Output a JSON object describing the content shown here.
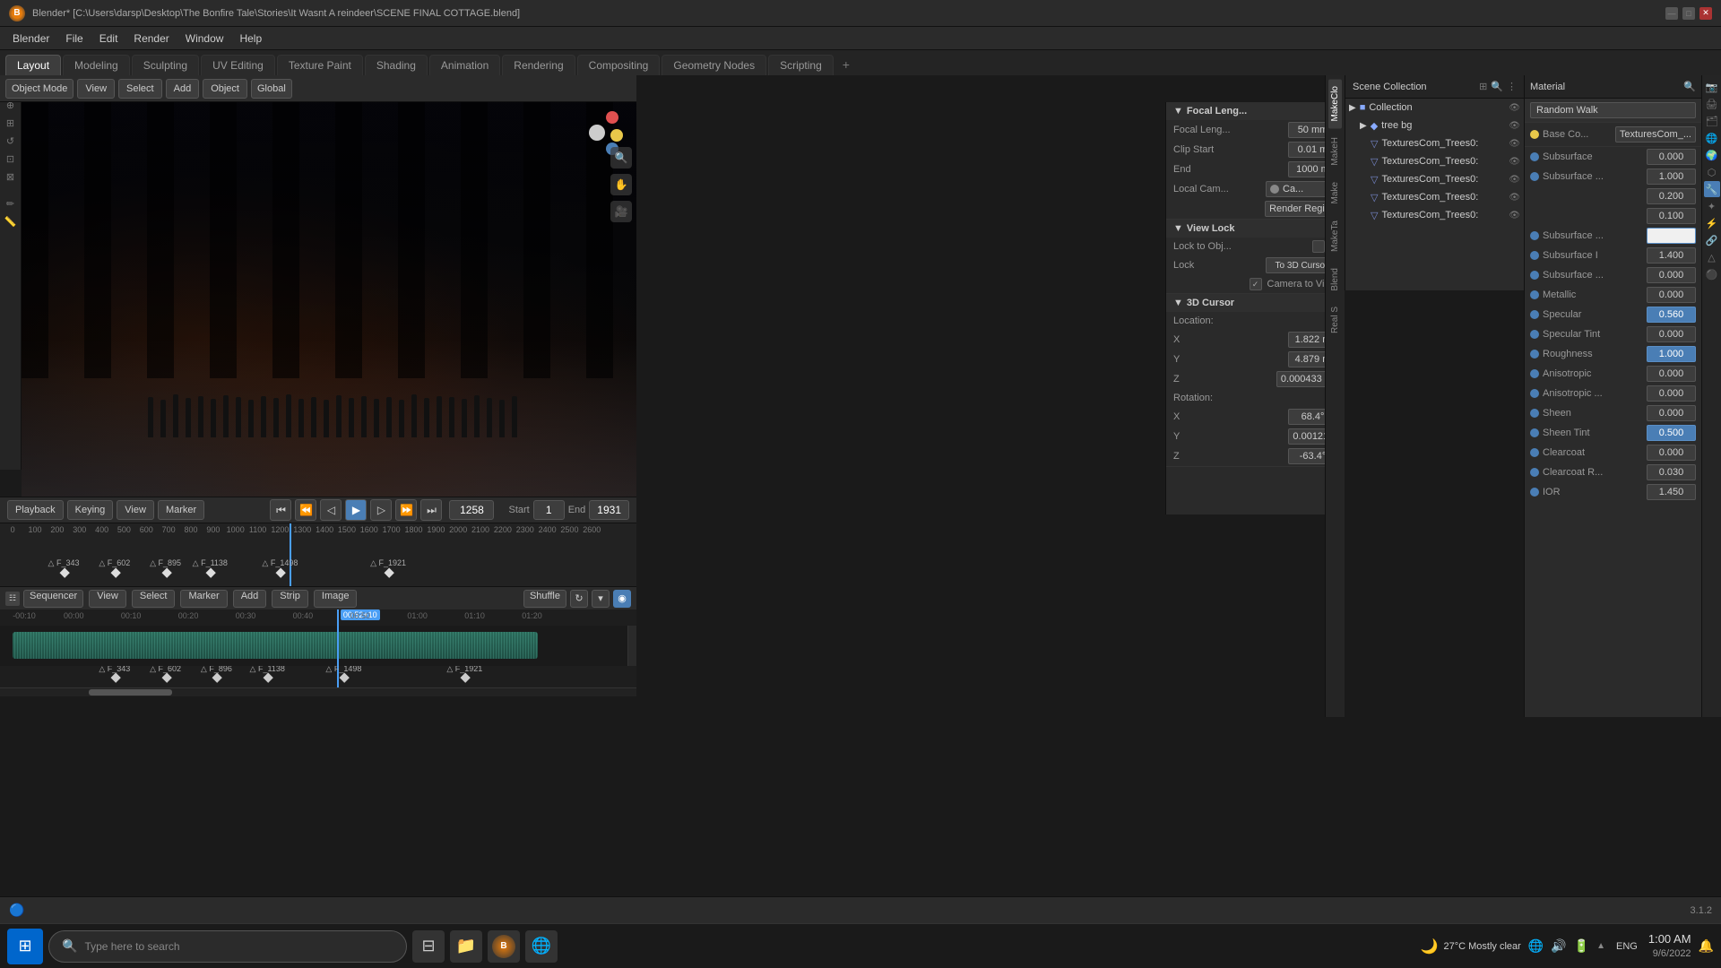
{
  "window": {
    "title": "Blender* [C:\\Users\\darsp\\Desktop\\The Bonfire Tale\\Stories\\It Wasnt A reindeer\\SCENE FINAL COTTAGE.blend]",
    "controls": {
      "minimize": "—",
      "maximize": "□",
      "close": "✕"
    }
  },
  "menu": {
    "items": [
      "Blender",
      "File",
      "Edit",
      "Render",
      "Window",
      "Help"
    ]
  },
  "workspaces": {
    "tabs": [
      "Layout",
      "Modeling",
      "Sculpting",
      "UV Editing",
      "Texture Paint",
      "Shading",
      "Animation",
      "Rendering",
      "Compositing",
      "Geometry Nodes",
      "Scripting"
    ],
    "active": "Layout"
  },
  "toolbar": {
    "mode": "Object Mode",
    "view": "View",
    "select": "Select",
    "add": "Add",
    "object": "Object",
    "transform": "Global",
    "pivot": "⊙"
  },
  "viewport": {
    "focal_length_label": "Focal Leng...",
    "focal_length_value": "50 mm",
    "clip_start_label": "Clip Start",
    "clip_start_value": "0.01 m",
    "end_label": "End",
    "end_value": "1000 m",
    "local_cam_label": "Local Cam...",
    "local_cam_value": "Ca...",
    "render_region_label": "Render Regi...",
    "view_lock_label": "View Lock",
    "lock_to_obj_label": "Lock to Obj...",
    "lock_to_cursor_label": "To 3D Cursor",
    "lock": "Lock",
    "camera_to_vi_label": "Camera to Vi...",
    "cursor_label": "3D Cursor",
    "cursor_location": {
      "x_label": "X",
      "x_value": "1.822 m",
      "y_label": "Y",
      "y_value": "4.879 m",
      "z_label": "Z",
      "z_value": "0.000433 m"
    },
    "cursor_rotation": {
      "label": "Rotation:",
      "x_label": "X",
      "x_value": "68.4°",
      "y_label": "Y",
      "y_value": "0.00121°",
      "z_label": "Z",
      "z_value": "-63.4°"
    }
  },
  "scene_outliner": {
    "collection_label": "Scene Collection",
    "collection": "Collection",
    "tree_bg": "tree bg",
    "items": [
      "TexturesCom_Trees0:",
      "TexturesCom_Trees0:",
      "TexturesCom_Trees0:",
      "TexturesCom_Trees0:",
      "TexturesCom_Trees0:"
    ]
  },
  "material": {
    "shader": "Random Walk",
    "base_color_label": "Base Co...",
    "base_color_value": "TexturesCom_...",
    "properties": [
      {
        "label": "Subsurface",
        "value": "0.000",
        "dot": "blue"
      },
      {
        "label": "Subsurface ...",
        "value": "1.000",
        "dot": "blue"
      },
      {
        "label": "",
        "value": "0.200",
        "dot": null
      },
      {
        "label": "",
        "value": "0.100",
        "dot": null
      },
      {
        "label": "Subsurface ...",
        "value": "",
        "dot": "blue",
        "white_box": true
      },
      {
        "label": "Subsurface I",
        "value": "1.400",
        "dot": "blue"
      },
      {
        "label": "Subsurface ...",
        "value": "0.000",
        "dot": "blue"
      },
      {
        "label": "Metallic",
        "value": "0.000",
        "dot": "blue"
      },
      {
        "label": "Specular",
        "value": "0.560",
        "dot": "blue",
        "highlighted": true
      },
      {
        "label": "Specular Tint",
        "value": "0.000",
        "dot": "blue"
      },
      {
        "label": "Roughness",
        "value": "1.000",
        "dot": "blue",
        "highlighted": true
      },
      {
        "label": "Anisotropic",
        "value": "0.000",
        "dot": "blue"
      },
      {
        "label": "Anisotropic ...",
        "value": "0.000",
        "dot": "blue"
      },
      {
        "label": "Sheen",
        "value": "0.000",
        "dot": "blue"
      },
      {
        "label": "Sheen Tint",
        "value": "0.500",
        "dot": "blue",
        "highlighted": true
      },
      {
        "label": "Clearcoat",
        "value": "0.000",
        "dot": "blue"
      },
      {
        "label": "Clearcoat R...",
        "value": "0.030",
        "dot": "blue"
      },
      {
        "label": "IOR",
        "value": "1.450",
        "dot": "blue"
      }
    ]
  },
  "timeline": {
    "playback_label": "Playback",
    "keying_label": "Keying",
    "view_label": "View",
    "marker_label": "Marker",
    "start_label": "Start",
    "start_value": "1",
    "end_label": "End",
    "end_value": "1931",
    "current_frame": "1258",
    "ruler_marks": [
      "0",
      "100",
      "200",
      "300",
      "400",
      "500",
      "600",
      "700",
      "800",
      "900",
      "1000",
      "1100",
      "1200",
      "1300",
      "1400",
      "1500",
      "1600",
      "1700",
      "1800",
      "1900",
      "2000",
      "2100",
      "2200",
      "2300",
      "2400",
      "2500",
      "2600"
    ],
    "keyframes": [
      {
        "label": "F_343",
        "pos_pct": 10
      },
      {
        "label": "F_602",
        "pos_pct": 18
      },
      {
        "label": "F_895",
        "pos_pct": 26
      },
      {
        "label": "F_1138",
        "pos_pct": 33
      },
      {
        "label": "F_1498",
        "pos_pct": 44
      },
      {
        "label": "F_1921",
        "pos_pct": 61
      }
    ]
  },
  "sequencer": {
    "sequencer_label": "Sequencer",
    "view_label": "View",
    "select_label": "Select",
    "marker_label": "Marker",
    "add_label": "Add",
    "strip_label": "Strip",
    "image_label": "Image",
    "shuffle_label": "Shuffle",
    "time_marks": [
      "-00:10",
      "00:00",
      "00:10",
      "00:20",
      "00:30",
      "00:40",
      "00:50",
      "01:00",
      "01:10",
      "01:20"
    ],
    "cursor_time": "00:52+10",
    "seq_keyframes": [
      {
        "label": "F_343",
        "pos_pct": 18
      },
      {
        "label": "F_602",
        "pos_pct": 26
      },
      {
        "label": "F_896",
        "pos_pct": 34
      },
      {
        "label": "F_1138",
        "pos_pct": 42
      },
      {
        "label": "F_1498",
        "pos_pct": 54
      },
      {
        "label": "F_1921",
        "pos_pct": 73
      }
    ]
  },
  "status_bar": {
    "version": "3.1.2"
  },
  "taskbar": {
    "search_placeholder": "Type here to search",
    "time": "1:00 AM",
    "date": "9/6/2022",
    "weather": "27°C  Mostly clear",
    "language": "ENG"
  },
  "side_tabs": [
    "MakeClo",
    "MakeH",
    "Make",
    "MakeTa",
    "Blend",
    "Real S"
  ],
  "props_icons": [
    "▼",
    "◉",
    "△",
    "⬡",
    "⚙",
    "🔗",
    "📷",
    "💡",
    "🌐",
    "⚫",
    "🎬",
    "🔊"
  ]
}
